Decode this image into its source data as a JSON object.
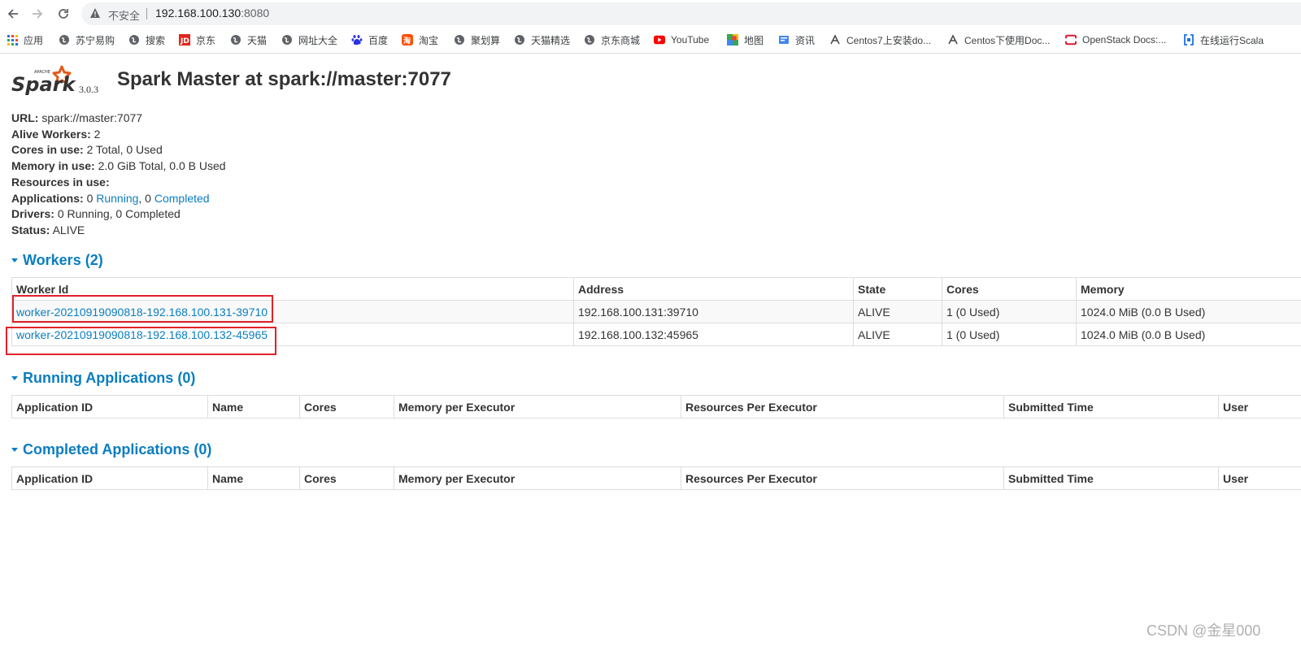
{
  "browser": {
    "insecure_label": "不安全",
    "url_host": "192.168.100.130",
    "url_port": ":8080",
    "bookmarks": [
      "应用",
      "苏宁易购",
      "搜索",
      "京东",
      "天猫",
      "网址大全",
      "百度",
      "淘宝",
      "聚划算",
      "天猫精选",
      "京东商城",
      "YouTube",
      "地图",
      "资讯",
      "Centos7上安装do...",
      "Centos下使用Doc...",
      "OpenStack Docs:...",
      "在线运行Scala"
    ]
  },
  "header": {
    "logo_text": "Spark",
    "logo_small": "APACHE",
    "version": "3.0.3",
    "title": "Spark Master at spark://master:7077"
  },
  "info": {
    "url_label": "URL:",
    "url_value": "spark://master:7077",
    "alive_label": "Alive Workers:",
    "alive_value": "2",
    "cores_label": "Cores in use:",
    "cores_value": "2 Total, 0 Used",
    "memory_label": "Memory in use:",
    "memory_value": "2.0 GiB Total, 0.0 B Used",
    "resources_label": "Resources in use:",
    "apps_label": "Applications:",
    "apps_running_count": "0",
    "apps_running_link": "Running",
    "apps_sep": ", 0",
    "apps_completed_link": "Completed",
    "drivers_label": "Drivers:",
    "drivers_value": "0 Running, 0 Completed",
    "status_label": "Status:",
    "status_value": "ALIVE"
  },
  "workers": {
    "heading": "Workers (2)",
    "columns": [
      "Worker Id",
      "Address",
      "State",
      "Cores",
      "Memory"
    ],
    "rows": [
      [
        "worker-20210919090818-192.168.100.131-39710",
        "192.168.100.131:39710",
        "ALIVE",
        "1 (0 Used)",
        "1024.0 MiB (0.0 B Used)"
      ],
      [
        "worker-20210919090818-192.168.100.132-45965",
        "192.168.100.132:45965",
        "ALIVE",
        "1 (0 Used)",
        "1024.0 MiB (0.0 B Used)"
      ]
    ]
  },
  "running_apps": {
    "heading": "Running Applications (0)",
    "columns": [
      "Application ID",
      "Name",
      "Cores",
      "Memory per Executor",
      "Resources Per Executor",
      "Submitted Time",
      "User"
    ]
  },
  "completed_apps": {
    "heading": "Completed Applications (0)",
    "columns": [
      "Application ID",
      "Name",
      "Cores",
      "Memory per Executor",
      "Resources Per Executor",
      "Submitted Time",
      "User"
    ]
  },
  "watermark": "CSDN @金星000",
  "colors": {
    "link": "#0a7dc1",
    "highlight": "#e0222b",
    "spark_star": "#e25a1c"
  }
}
